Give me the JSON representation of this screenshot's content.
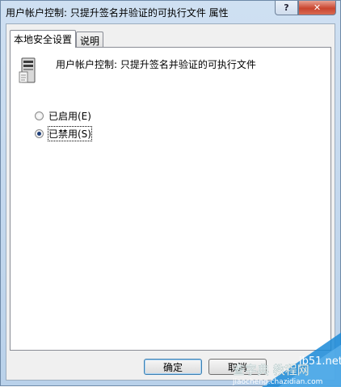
{
  "window": {
    "title": "用户帐户控制: 只提升签名并验证的可执行文件 属性",
    "help_label": "?",
    "close_label": "✕"
  },
  "tabs": [
    {
      "label": "本地安全设置",
      "active": true
    },
    {
      "label": "说明",
      "active": false
    }
  ],
  "policy": {
    "icon": "server-icon",
    "heading": "用户帐户控制: 只提升签名并验证的可执行文件"
  },
  "options": [
    {
      "label": "已启用(E)",
      "checked": false
    },
    {
      "label": "已禁用(S)",
      "checked": true
    }
  ],
  "buttons": {
    "ok": "确定",
    "cancel": "取消"
  },
  "watermark": {
    "text_top": "jb51.net",
    "text_main": "查字典 教程网",
    "text_url": "jiaocheng.chazidian.com",
    "color": "#1a8ad8"
  }
}
